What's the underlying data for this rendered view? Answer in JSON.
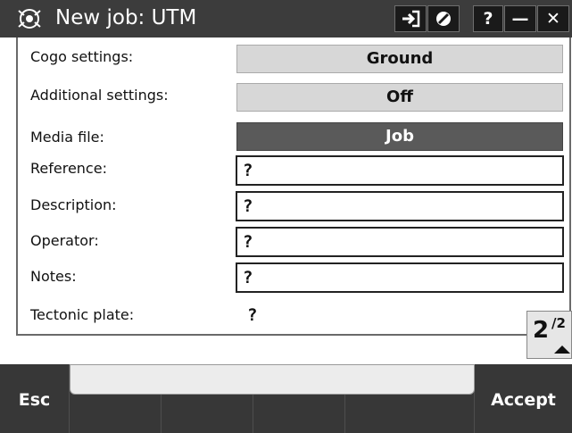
{
  "window": {
    "title": "New job: UTM",
    "buttons": {
      "login_icon": "login-icon",
      "disable_icon": "disable-icon",
      "help": "?",
      "minimize": "—",
      "close": "✕"
    }
  },
  "form": {
    "cogo_settings": {
      "label": "Cogo settings:",
      "value": "Ground"
    },
    "additional_settings": {
      "label": "Additional settings:",
      "value": "Off"
    },
    "media_file": {
      "label": "Media file:",
      "value": "Job"
    },
    "reference": {
      "label": "Reference:",
      "value": "?"
    },
    "description": {
      "label": "Description:",
      "value": "?"
    },
    "operator": {
      "label": "Operator:",
      "value": "?"
    },
    "notes": {
      "label": "Notes:",
      "value": "?"
    },
    "tectonic_plate": {
      "label": "Tectonic plate:",
      "value": "?"
    }
  },
  "pager": {
    "current": "2",
    "total": "/2"
  },
  "softkeys": {
    "esc": "Esc",
    "accept": "Accept"
  },
  "colors": {
    "titlebar": "#3c3c3c",
    "selected_field": "#5a5a5a",
    "field_button": "#d7d7d7"
  }
}
